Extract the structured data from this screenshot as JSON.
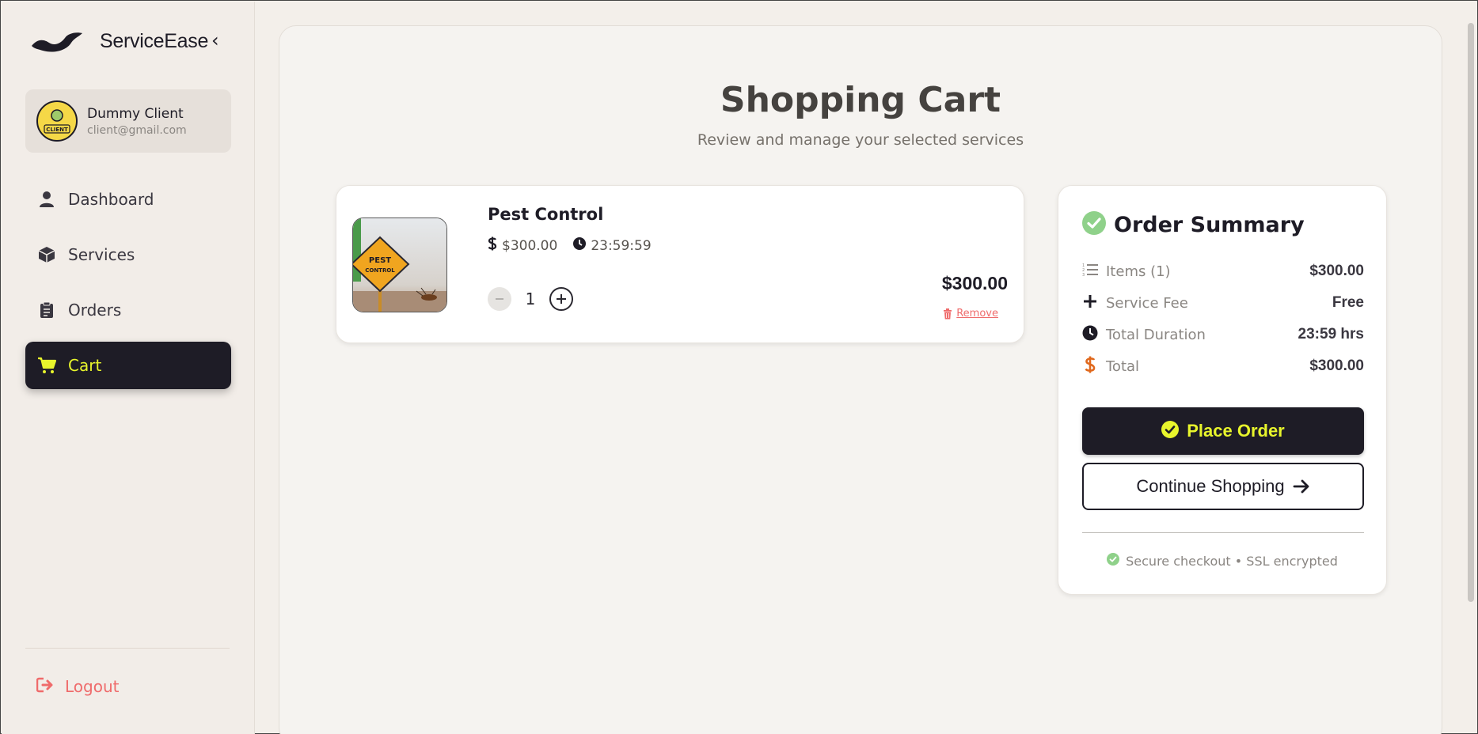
{
  "brand": {
    "name": "ServiceEase",
    "collapse_glyph": "‹"
  },
  "user": {
    "name": "Dummy Client",
    "email": "client@gmail.com",
    "avatar_badge": "CLIENT"
  },
  "nav": {
    "items": [
      {
        "label": "Dashboard",
        "icon": "user-icon",
        "active": false
      },
      {
        "label": "Services",
        "icon": "box-icon",
        "active": false
      },
      {
        "label": "Orders",
        "icon": "clipboard-icon",
        "active": false
      },
      {
        "label": "Cart",
        "icon": "cart-icon",
        "active": true
      }
    ],
    "logout_label": "Logout"
  },
  "page": {
    "title": "Shopping Cart",
    "subtitle": "Review and manage your selected services"
  },
  "cart_items": [
    {
      "name": "Pest Control",
      "price": "$300.00",
      "duration": "23:59:59",
      "quantity": "1",
      "line_total": "$300.00",
      "remove_label": "Remove",
      "image_sign": [
        "PEST",
        "CONTROL"
      ]
    }
  ],
  "summary": {
    "title": "Order Summary",
    "rows": [
      {
        "label": "Items (1)",
        "value": "$300.00",
        "icon": "list-icon"
      },
      {
        "label": "Service Fee",
        "value": "Free",
        "icon": "plus-icon"
      },
      {
        "label": "Total Duration",
        "value": "23:59 hrs",
        "icon": "clock-icon"
      },
      {
        "label": "Total",
        "value": "$300.00",
        "icon": "dollar-icon"
      }
    ],
    "place_order_label": "Place Order",
    "continue_label": "Continue Shopping",
    "secure_text": "Secure checkout • SSL encrypted"
  },
  "colors": {
    "dark": "#1e1c26",
    "accent": "#e8f52c",
    "danger": "#ef6b6b",
    "success": "#8fd18a",
    "total_icon": "#e0681c"
  }
}
